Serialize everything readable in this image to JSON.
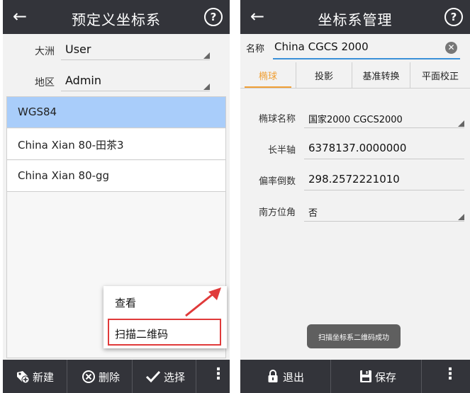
{
  "left": {
    "header": {
      "title": "预定义坐标系",
      "help": "?"
    },
    "fields": [
      {
        "label": "大洲",
        "value": "User"
      },
      {
        "label": "地区",
        "value": "Admin"
      }
    ],
    "list": [
      "WGS84",
      "China Xian 80-田茶3",
      "China Xian 80-gg"
    ],
    "context_menu": [
      "查看",
      "扫描二维码"
    ],
    "bottom": {
      "new": "新建",
      "delete": "删除",
      "select": "选择"
    },
    "colors": {
      "bar": "#33343a",
      "selected": "#a9cdfa",
      "highlight_box": "#e03a3a"
    }
  },
  "right": {
    "header": {
      "title": "坐标系管理",
      "help": "?"
    },
    "name": {
      "label": "名称",
      "value": "China CGCS 2000"
    },
    "tabs": [
      "椭球",
      "投影",
      "基准转换",
      "平面校正"
    ],
    "rows": [
      {
        "label": "椭球名称",
        "value": "国家2000 CGCS2000"
      },
      {
        "label": "长半轴",
        "value": "6378137.0000000"
      },
      {
        "label": "偏率倒数",
        "value": "298.2572221010"
      },
      {
        "label": "南方位角",
        "value": "否"
      }
    ],
    "toast": "扫描坐标系二维码成功",
    "bottom": {
      "exit": "退出",
      "save": "保存"
    },
    "colors": {
      "accent": "#f0a035",
      "input_line": "#3a90d8"
    }
  }
}
